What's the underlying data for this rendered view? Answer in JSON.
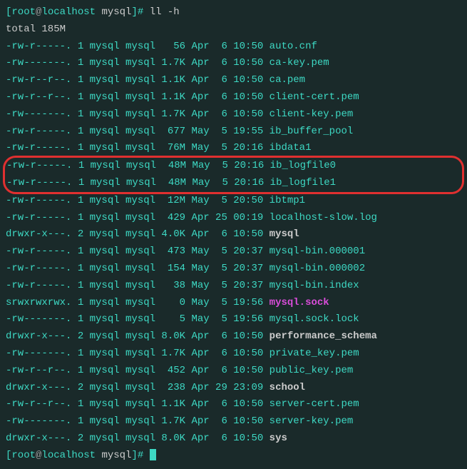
{
  "prompt": {
    "user": "root",
    "at": "@",
    "host": "localhost",
    "path": "mysql",
    "cmd": "ll -h"
  },
  "total": "total 185M",
  "rows": [
    {
      "perm": "-rw-r-----.",
      "links": "1",
      "owner": "mysql",
      "group": "mysql",
      "size": "56",
      "mon": "Apr",
      "day": "6",
      "time": "10:50",
      "name": "auto.cnf",
      "cls": "green"
    },
    {
      "perm": "-rw-------.",
      "links": "1",
      "owner": "mysql",
      "group": "mysql",
      "size": "1.7K",
      "mon": "Apr",
      "day": "6",
      "time": "10:50",
      "name": "ca-key.pem",
      "cls": "green"
    },
    {
      "perm": "-rw-r--r--.",
      "links": "1",
      "owner": "mysql",
      "group": "mysql",
      "size": "1.1K",
      "mon": "Apr",
      "day": "6",
      "time": "10:50",
      "name": "ca.pem",
      "cls": "green"
    },
    {
      "perm": "-rw-r--r--.",
      "links": "1",
      "owner": "mysql",
      "group": "mysql",
      "size": "1.1K",
      "mon": "Apr",
      "day": "6",
      "time": "10:50",
      "name": "client-cert.pem",
      "cls": "green"
    },
    {
      "perm": "-rw-------.",
      "links": "1",
      "owner": "mysql",
      "group": "mysql",
      "size": "1.7K",
      "mon": "Apr",
      "day": "6",
      "time": "10:50",
      "name": "client-key.pem",
      "cls": "green"
    },
    {
      "perm": "-rw-r-----.",
      "links": "1",
      "owner": "mysql",
      "group": "mysql",
      "size": "677",
      "mon": "May",
      "day": "5",
      "time": "19:55",
      "name": "ib_buffer_pool",
      "cls": "green"
    },
    {
      "perm": "-rw-r-----.",
      "links": "1",
      "owner": "mysql",
      "group": "mysql",
      "size": "76M",
      "mon": "May",
      "day": "5",
      "time": "20:16",
      "name": "ibdata1",
      "cls": "green"
    }
  ],
  "highlight_rows": [
    {
      "perm": "-rw-r-----.",
      "links": "1",
      "owner": "mysql",
      "group": "mysql",
      "size": "48M",
      "mon": "May",
      "day": "5",
      "time": "20:16",
      "name": "ib_logfile0",
      "cls": "green"
    },
    {
      "perm": "-rw-r-----.",
      "links": "1",
      "owner": "mysql",
      "group": "mysql",
      "size": "48M",
      "mon": "May",
      "day": "5",
      "time": "20:16",
      "name": "ib_logfile1",
      "cls": "green"
    }
  ],
  "rows2": [
    {
      "perm": "-rw-r-----.",
      "links": "1",
      "owner": "mysql",
      "group": "mysql",
      "size": "12M",
      "mon": "May",
      "day": "5",
      "time": "20:50",
      "name": "ibtmp1",
      "cls": "green"
    },
    {
      "perm": "-rw-r-----.",
      "links": "1",
      "owner": "mysql",
      "group": "mysql",
      "size": "429",
      "mon": "Apr",
      "day": "25",
      "time": "00:19",
      "name": "localhost-slow.log",
      "cls": "green"
    },
    {
      "perm": "drwxr-x---.",
      "links": "2",
      "owner": "mysql",
      "group": "mysql",
      "size": "4.0K",
      "mon": "Apr",
      "day": "6",
      "time": "10:50",
      "name": "mysql",
      "cls": "gray bold"
    },
    {
      "perm": "-rw-r-----.",
      "links": "1",
      "owner": "mysql",
      "group": "mysql",
      "size": "473",
      "mon": "May",
      "day": "5",
      "time": "20:37",
      "name": "mysql-bin.000001",
      "cls": "green"
    },
    {
      "perm": "-rw-r-----.",
      "links": "1",
      "owner": "mysql",
      "group": "mysql",
      "size": "154",
      "mon": "May",
      "day": "5",
      "time": "20:37",
      "name": "mysql-bin.000002",
      "cls": "green"
    },
    {
      "perm": "-rw-r-----.",
      "links": "1",
      "owner": "mysql",
      "group": "mysql",
      "size": "38",
      "mon": "May",
      "day": "5",
      "time": "20:37",
      "name": "mysql-bin.index",
      "cls": "green"
    },
    {
      "perm": "srwxrwxrwx.",
      "links": "1",
      "owner": "mysql",
      "group": "mysql",
      "size": "0",
      "mon": "May",
      "day": "5",
      "time": "19:56",
      "name": "mysql.sock",
      "cls": "magenta bold"
    },
    {
      "perm": "-rw-------.",
      "links": "1",
      "owner": "mysql",
      "group": "mysql",
      "size": "5",
      "mon": "May",
      "day": "5",
      "time": "19:56",
      "name": "mysql.sock.lock",
      "cls": "green"
    },
    {
      "perm": "drwxr-x---.",
      "links": "2",
      "owner": "mysql",
      "group": "mysql",
      "size": "8.0K",
      "mon": "Apr",
      "day": "6",
      "time": "10:50",
      "name": "performance_schema",
      "cls": "gray bold"
    },
    {
      "perm": "-rw-------.",
      "links": "1",
      "owner": "mysql",
      "group": "mysql",
      "size": "1.7K",
      "mon": "Apr",
      "day": "6",
      "time": "10:50",
      "name": "private_key.pem",
      "cls": "green"
    },
    {
      "perm": "-rw-r--r--.",
      "links": "1",
      "owner": "mysql",
      "group": "mysql",
      "size": "452",
      "mon": "Apr",
      "day": "6",
      "time": "10:50",
      "name": "public_key.pem",
      "cls": "green"
    },
    {
      "perm": "drwxr-x---.",
      "links": "2",
      "owner": "mysql",
      "group": "mysql",
      "size": "238",
      "mon": "Apr",
      "day": "29",
      "time": "23:09",
      "name": "school",
      "cls": "gray bold"
    },
    {
      "perm": "-rw-r--r--.",
      "links": "1",
      "owner": "mysql",
      "group": "mysql",
      "size": "1.1K",
      "mon": "Apr",
      "day": "6",
      "time": "10:50",
      "name": "server-cert.pem",
      "cls": "green"
    },
    {
      "perm": "-rw-------.",
      "links": "1",
      "owner": "mysql",
      "group": "mysql",
      "size": "1.7K",
      "mon": "Apr",
      "day": "6",
      "time": "10:50",
      "name": "server-key.pem",
      "cls": "green"
    },
    {
      "perm": "drwxr-x---.",
      "links": "2",
      "owner": "mysql",
      "group": "mysql",
      "size": "8.0K",
      "mon": "Apr",
      "day": "6",
      "time": "10:50",
      "name": "sys",
      "cls": "gray bold"
    }
  ]
}
